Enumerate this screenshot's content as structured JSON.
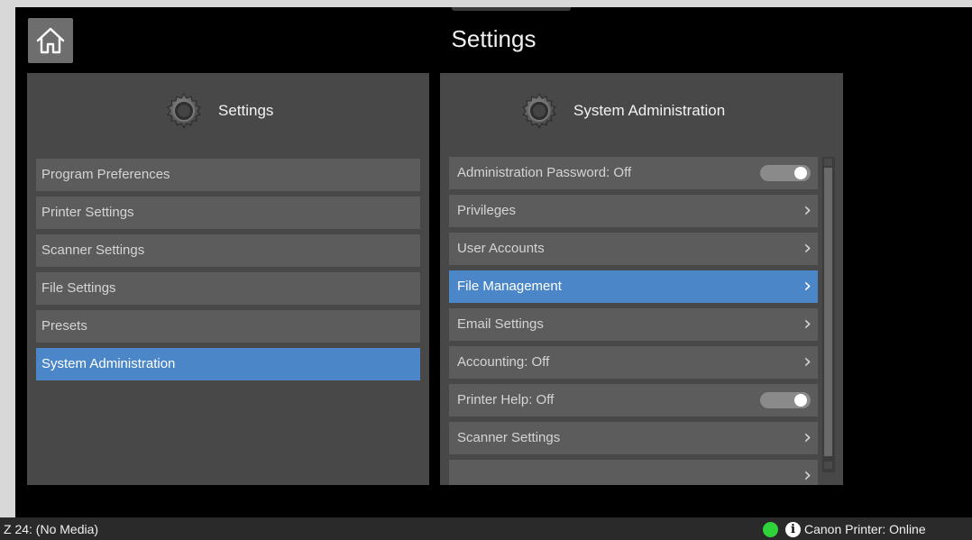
{
  "header": {
    "title": "Settings",
    "home_icon": "home-icon"
  },
  "left_panel": {
    "title": "Settings",
    "icon": "gear-icon",
    "items": [
      {
        "label": "Program Preferences",
        "selected": false
      },
      {
        "label": "Printer Settings",
        "selected": false
      },
      {
        "label": "Scanner Settings",
        "selected": false
      },
      {
        "label": "File Settings",
        "selected": false
      },
      {
        "label": "Presets",
        "selected": false
      },
      {
        "label": "System Administration",
        "selected": true
      }
    ]
  },
  "right_panel": {
    "title": "System Administration",
    "icon": "gear-icon",
    "items": [
      {
        "label": "Administration Password: Off",
        "control": "toggle",
        "selected": false
      },
      {
        "label": "Privileges",
        "control": "chevron",
        "selected": false
      },
      {
        "label": "User Accounts",
        "control": "chevron",
        "selected": false
      },
      {
        "label": "File Management",
        "control": "chevron",
        "selected": true
      },
      {
        "label": "Email Settings",
        "control": "chevron",
        "selected": false
      },
      {
        "label": "Accounting: Off",
        "control": "chevron",
        "selected": false
      },
      {
        "label": "Printer Help: Off",
        "control": "toggle",
        "selected": false
      },
      {
        "label": "Scanner Settings",
        "control": "chevron",
        "selected": false
      },
      {
        "label": "",
        "control": "chevron",
        "selected": false
      }
    ]
  },
  "chevron_glyph": "›",
  "status_bar": {
    "media": "Z 24: (No Media)",
    "printer_status": "Canon Printer: Online",
    "status_color": "#2fd33a",
    "info_glyph": "i"
  },
  "colors": {
    "accent": "#4a86c8",
    "panel": "#484848",
    "item": "#5c5c5c"
  }
}
